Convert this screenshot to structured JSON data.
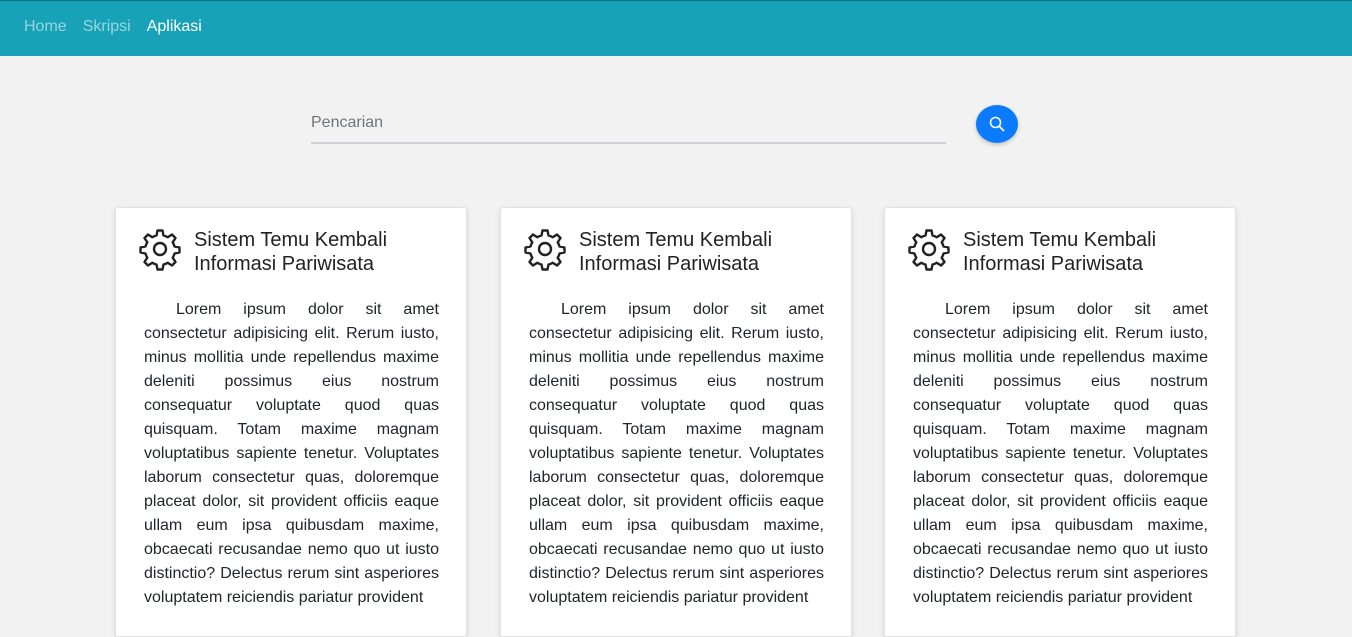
{
  "nav": {
    "items": [
      {
        "label": "Home",
        "active": false
      },
      {
        "label": "Skripsi",
        "active": false
      },
      {
        "label": "Aplikasi",
        "active": true
      }
    ]
  },
  "search": {
    "placeholder": "Pencarian",
    "value": "",
    "button_icon": "search-icon"
  },
  "colors": {
    "navbar": "#17a2b8",
    "search_button": "#0a7bfd",
    "background": "#f2f2f2"
  },
  "cards": [
    {
      "icon": "gear-icon",
      "title": "Sistem Temu Kembali Informasi Pariwisata",
      "body": "Lorem ipsum dolor sit amet consectetur adipisicing elit. Rerum iusto, minus mollitia unde repellendus maxime deleniti possimus eius nostrum consequatur voluptate quod quas quisquam. Totam maxime magnam voluptatibus sapiente tenetur. Voluptates laborum consectetur quas, doloremque placeat dolor, sit provident officiis eaque ullam eum ipsa quibusdam maxime, obcaecati recusandae nemo quo ut iusto distinctio? Delectus rerum sint asperiores voluptatem reiciendis pariatur provident"
    },
    {
      "icon": "gear-icon",
      "title": "Sistem Temu Kembali Informasi Pariwisata",
      "body": "Lorem ipsum dolor sit amet consectetur adipisicing elit. Rerum iusto, minus mollitia unde repellendus maxime deleniti possimus eius nostrum consequatur voluptate quod quas quisquam. Totam maxime magnam voluptatibus sapiente tenetur. Voluptates laborum consectetur quas, doloremque placeat dolor, sit provident officiis eaque ullam eum ipsa quibusdam maxime, obcaecati recusandae nemo quo ut iusto distinctio? Delectus rerum sint asperiores voluptatem reiciendis pariatur provident"
    },
    {
      "icon": "gear-icon",
      "title": "Sistem Temu Kembali Informasi Pariwisata",
      "body": "Lorem ipsum dolor sit amet consectetur adipisicing elit. Rerum iusto, minus mollitia unde repellendus maxime deleniti possimus eius nostrum consequatur voluptate quod quas quisquam. Totam maxime magnam voluptatibus sapiente tenetur. Voluptates laborum consectetur quas, doloremque placeat dolor, sit provident officiis eaque ullam eum ipsa quibusdam maxime, obcaecati recusandae nemo quo ut iusto distinctio? Delectus rerum sint asperiores voluptatem reiciendis pariatur provident"
    }
  ]
}
